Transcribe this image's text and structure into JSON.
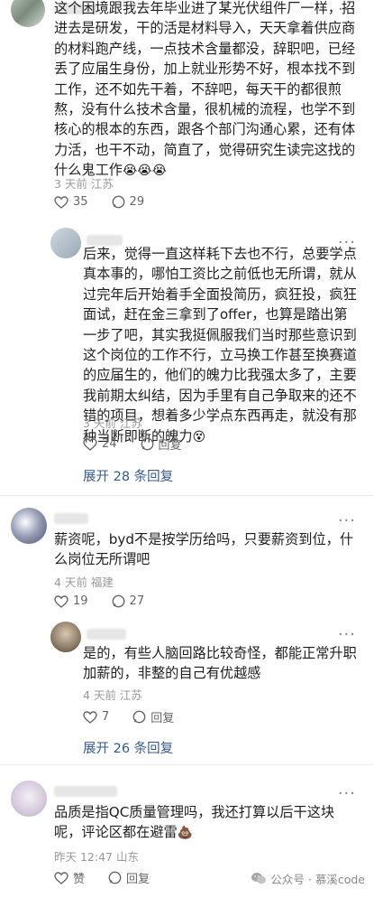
{
  "comments": [
    {
      "text": "这个困境跟我去年毕业进了某光伏组件厂一样，招进去是研发，干的活是材料导入，天天拿着供应商的材料跑产线，一点技术含量都没，辞职吧，已经丢了应届生身份，加上就业形势不好，根本找不到工作，还不如先干着，不辞吧，每天干的都很煎熬，没有什么技术含量，很机械的流程，也学不到核心的根本的东西，跟各个部门沟通心累，还有体力活，也干不动，简直了，觉得研究生读完这找的什么鬼工作",
      "emoji": "😭😭😭",
      "time": "3 天前",
      "location": "江苏",
      "likes": "35",
      "replies": "29"
    },
    {
      "text": "后来，觉得一直这样耗下去也不行，总要学点真本事的，哪怕工资比之前低也无所谓，就从过完年后开始着手全面投简历，疯狂投，疯狂面试，赶在金三拿到了offer，也算是踏出第一步了吧，其实我挺佩服我们当时那些意识到这个岗位的工作不行，立马换工作甚至换赛道的应届生的，他们的魄力比我强太多了，主要我前期太纠结，因为手里有自己争取来的还不错的项目，想着多少学点东西再走，就没有那种当断即断的魄力",
      "emoji": "😵",
      "time": "3 天前",
      "location": "江苏",
      "likes": "24",
      "reply_label": "回复",
      "expand": "展开 28 条回复"
    },
    {
      "text": "薪资呢，byd不是按学历给吗，只要薪资到位，什么岗位无所谓吧",
      "time": "4 天前",
      "location": "福建",
      "likes": "19",
      "replies": "27"
    },
    {
      "text": "是的，有些人脑回路比较奇怪，都能正常升职加薪的，非整的自己有优越感",
      "time": "4 天前",
      "location": "江苏",
      "likes": "7",
      "reply_label": "回复",
      "expand": "展开 26 条回复"
    },
    {
      "text": "品质是指QC质量管理吗，我还打算以后干这块呢，评论区都在避雷",
      "emoji": "💩",
      "time": "昨天 12:47",
      "location": "山东",
      "likes": "赞",
      "reply_label": "回复"
    }
  ],
  "more_icon": "···",
  "watermark": "公众号 · 慕溪code",
  "colors": {
    "link": "#3a5a88",
    "meta": "#9a9a9a"
  }
}
